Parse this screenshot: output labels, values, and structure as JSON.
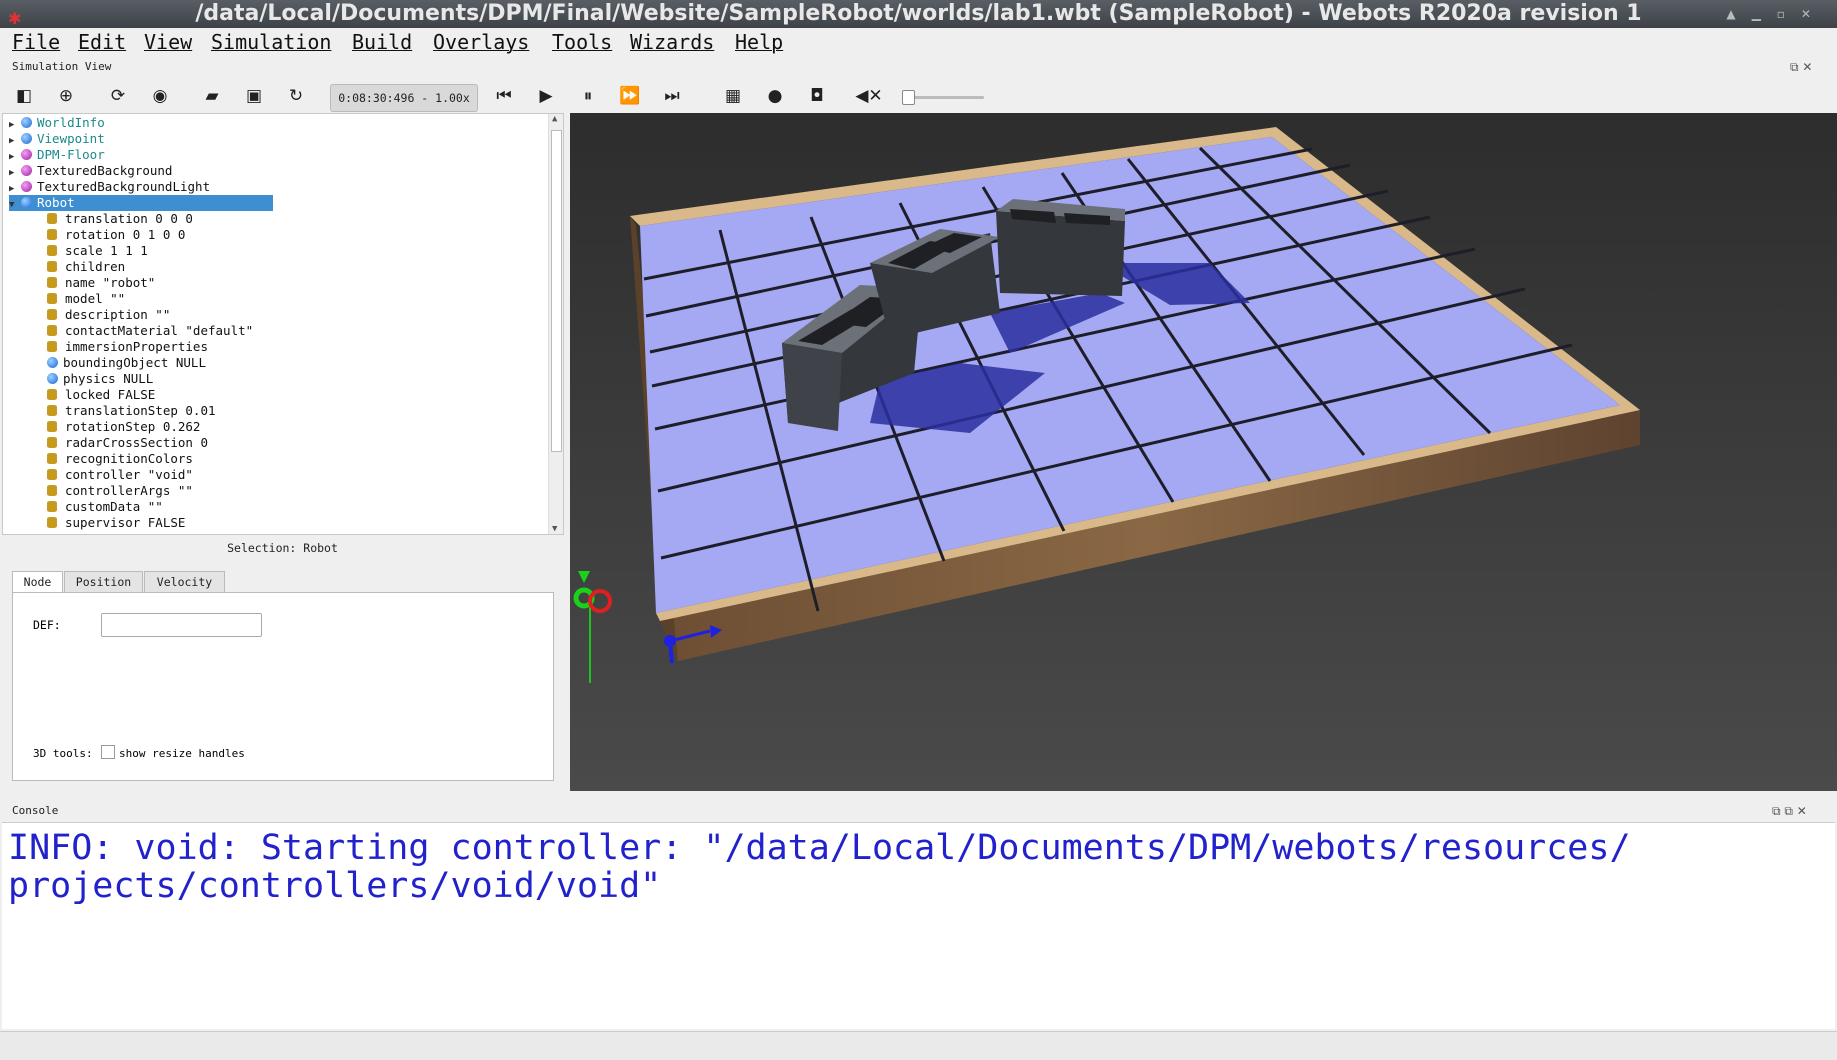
{
  "window": {
    "title": "/data/Local/Documents/DPM/Final/Website/SampleRobot/worlds/lab1.wbt (SampleRobot) - Webots R2020a revision 1"
  },
  "menu": [
    "File",
    "Edit",
    "View",
    "Simulation",
    "Build",
    "Overlays",
    "Tools",
    "Wizards",
    "Help"
  ],
  "simulation_view": {
    "label": "Simulation View",
    "time": "0:08:30:496 -  1.00x"
  },
  "scene_tree": [
    {
      "label": "WorldInfo",
      "icon": "blue-sphere",
      "level": 0,
      "expanded": false,
      "style": "proto"
    },
    {
      "label": "Viewpoint",
      "icon": "blue-sphere",
      "level": 0,
      "expanded": false,
      "style": "proto"
    },
    {
      "label": "DPM-Floor",
      "icon": "magenta-sphere",
      "level": 0,
      "expanded": false,
      "style": "proto"
    },
    {
      "label": "TexturedBackground",
      "icon": "magenta-sphere",
      "level": 0,
      "expanded": false,
      "style": "normal"
    },
    {
      "label": "TexturedBackgroundLight",
      "icon": "magenta-sphere",
      "level": 0,
      "expanded": false,
      "style": "normal"
    },
    {
      "label": "Robot",
      "icon": "blue-sphere",
      "level": 0,
      "expanded": true,
      "style": "selected"
    },
    {
      "label": "translation 0 0 0",
      "icon": "field",
      "level": 1
    },
    {
      "label": "rotation 0 1 0 0",
      "icon": "field",
      "level": 1
    },
    {
      "label": "scale 1 1 1",
      "icon": "field",
      "level": 1
    },
    {
      "label": "children",
      "icon": "field",
      "level": 1
    },
    {
      "label": "name \"robot\"",
      "icon": "field",
      "level": 1
    },
    {
      "label": "model \"\"",
      "icon": "field",
      "level": 1
    },
    {
      "label": "description \"\"",
      "icon": "field",
      "level": 1
    },
    {
      "label": "contactMaterial \"default\"",
      "icon": "field",
      "level": 1
    },
    {
      "label": "immersionProperties",
      "icon": "field",
      "level": 1
    },
    {
      "label": "boundingObject NULL",
      "icon": "blue-sphere",
      "level": 1
    },
    {
      "label": "physics NULL",
      "icon": "blue-sphere",
      "level": 1
    },
    {
      "label": "locked FALSE",
      "icon": "field",
      "level": 1
    },
    {
      "label": "translationStep 0.01",
      "icon": "field",
      "level": 1
    },
    {
      "label": "rotationStep 0.262",
      "icon": "field",
      "level": 1
    },
    {
      "label": "radarCrossSection 0",
      "icon": "field",
      "level": 1
    },
    {
      "label": "recognitionColors",
      "icon": "field",
      "level": 1
    },
    {
      "label": "controller \"void\"",
      "icon": "field",
      "level": 1
    },
    {
      "label": "controllerArgs \"\"",
      "icon": "field",
      "level": 1
    },
    {
      "label": "customData \"\"",
      "icon": "field",
      "level": 1
    },
    {
      "label": "supervisor FALSE",
      "icon": "field",
      "level": 1
    }
  ],
  "selection": {
    "label": "Selection: Robot",
    "tabs": [
      "Node",
      "Position",
      "Velocity"
    ],
    "active_tab": "Node",
    "def_label": "DEF:",
    "def_value": "",
    "tools_label": "3D tools:",
    "resize_label": "show resize handles",
    "resize_checked": false
  },
  "console": {
    "label": "Console",
    "text": "INFO: void: Starting controller: \"/data/Local/Documents/DPM/webots/resources/\nprojects/controllers/void/void\""
  },
  "colors": {
    "floor_tile": "#a5a8f2",
    "wall_wood": "#c9a06b",
    "block": "#3a3d42",
    "shadow": "#2a2fa0",
    "console_text": "#2222cc",
    "selection": "#3d8fd1"
  }
}
